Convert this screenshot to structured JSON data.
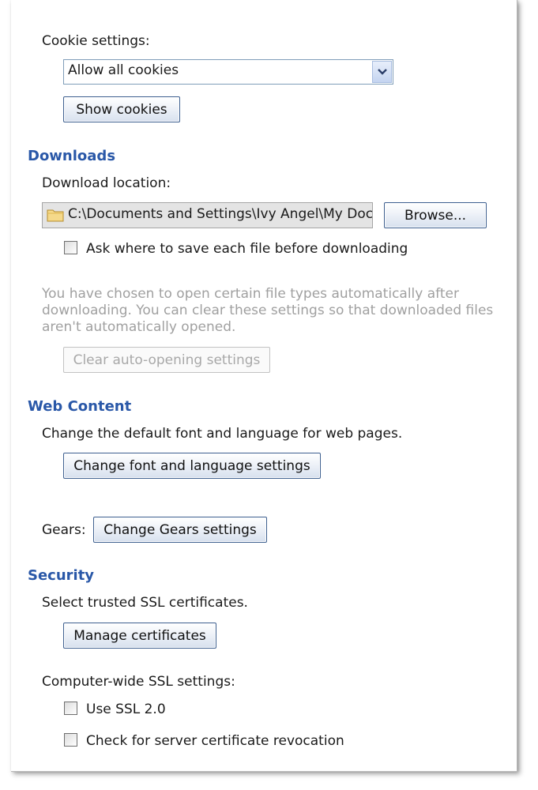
{
  "cookies": {
    "label": "Cookie settings:",
    "selected": "Allow all cookies",
    "show_button": "Show cookies"
  },
  "downloads": {
    "heading": "Downloads",
    "location_label": "Download location:",
    "path": "C:\\Documents and Settings\\Ivy Angel\\My Documents\\Downloads",
    "browse_button": "Browse...",
    "ask_checkbox": "Ask where to save each file before downloading",
    "auto_open_note_1": "You have chosen to open certain file types automatically after",
    "auto_open_note_2": "downloading. You can clear these settings so that downloaded files",
    "auto_open_note_3": "aren't automatically opened.",
    "clear_button": "Clear auto-opening settings"
  },
  "web_content": {
    "heading": "Web Content",
    "description": "Change the default font and language for web pages.",
    "font_button": "Change font and language settings",
    "gears_label": "Gears:",
    "gears_button": "Change Gears settings"
  },
  "security": {
    "heading": "Security",
    "ssl_description": "Select trusted SSL certificates.",
    "manage_button": "Manage certificates",
    "ssl_settings_label": "Computer-wide SSL settings:",
    "ssl2_checkbox": "Use SSL 2.0",
    "revocation_checkbox": "Check for server certificate revocation"
  },
  "colors": {
    "heading": "#2a58a8",
    "button_border": "#3d5f8f",
    "muted_text": "#a0a0a0"
  },
  "icons": {
    "dropdown": "chevron-down-icon",
    "folder": "folder-icon",
    "checkbox": "checkbox-unchecked"
  }
}
